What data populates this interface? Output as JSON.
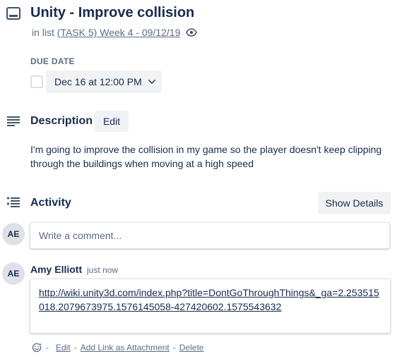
{
  "card": {
    "title": "Unity - Improve collision",
    "in_list_prefix": "in list",
    "list_name": "(TASK 5) Week 4 - 09/12/19"
  },
  "due": {
    "label": "DUE DATE",
    "value": "Dec 16 at 12:00 PM"
  },
  "description": {
    "title": "Description",
    "edit_label": "Edit",
    "text": "I'm going to improve the collision in my game so the player doesn't keep clipping through the buildings when moving at a high speed"
  },
  "activity": {
    "title": "Activity",
    "show_details_label": "Show Details",
    "current_user_initials": "AE",
    "comment_placeholder": "Write a comment...",
    "comments": [
      {
        "author_initials": "AE",
        "author": "Amy Elliott",
        "time": "just now",
        "link_text": "http://wiki.unity3d.com/index.php?title=DontGoThroughThings&_ga=2.253515018.2079673975.1576145058-427420602.1575543632",
        "actions": {
          "dash": "-",
          "edit": "Edit",
          "add_link": "Add Link as Attachment",
          "delete": "Delete"
        }
      }
    ]
  },
  "colors": {
    "text_primary": "#172b4d",
    "text_subtle": "#5e6c84",
    "button_bg": "#f1f2f4",
    "border": "#dfe1e6"
  }
}
